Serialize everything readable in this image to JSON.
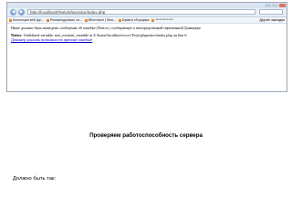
{
  "browser": {
    "address": "http://localhost/Testy/phpnotice/index.php",
    "bookmarks": [
      "Коллекция веб-фр...",
      "Рекомендуемые си...",
      "ВКонтакте | Моя...",
      "Бумаги сборщика",
      "**************"
    ],
    "other_bookmarks": "Другие закладки"
  },
  "page_text": {
    "intro": "Ниже должно быть выведено сообщение об ошибке (Notice), сообщающее о неопределённой переменной Доминера",
    "notice_label": "Notice",
    "notice_text": ": Undefined variable: non_existent_variable in Z:\\home\\localhost\\www\\Testy\\phpnotice\\index.php on line 6",
    "link": "Доминер доказать возможности причине ошибки!"
  },
  "slide": {
    "heading": "Проверяем работоспособность сервера",
    "caption": "Должно быть так:"
  }
}
